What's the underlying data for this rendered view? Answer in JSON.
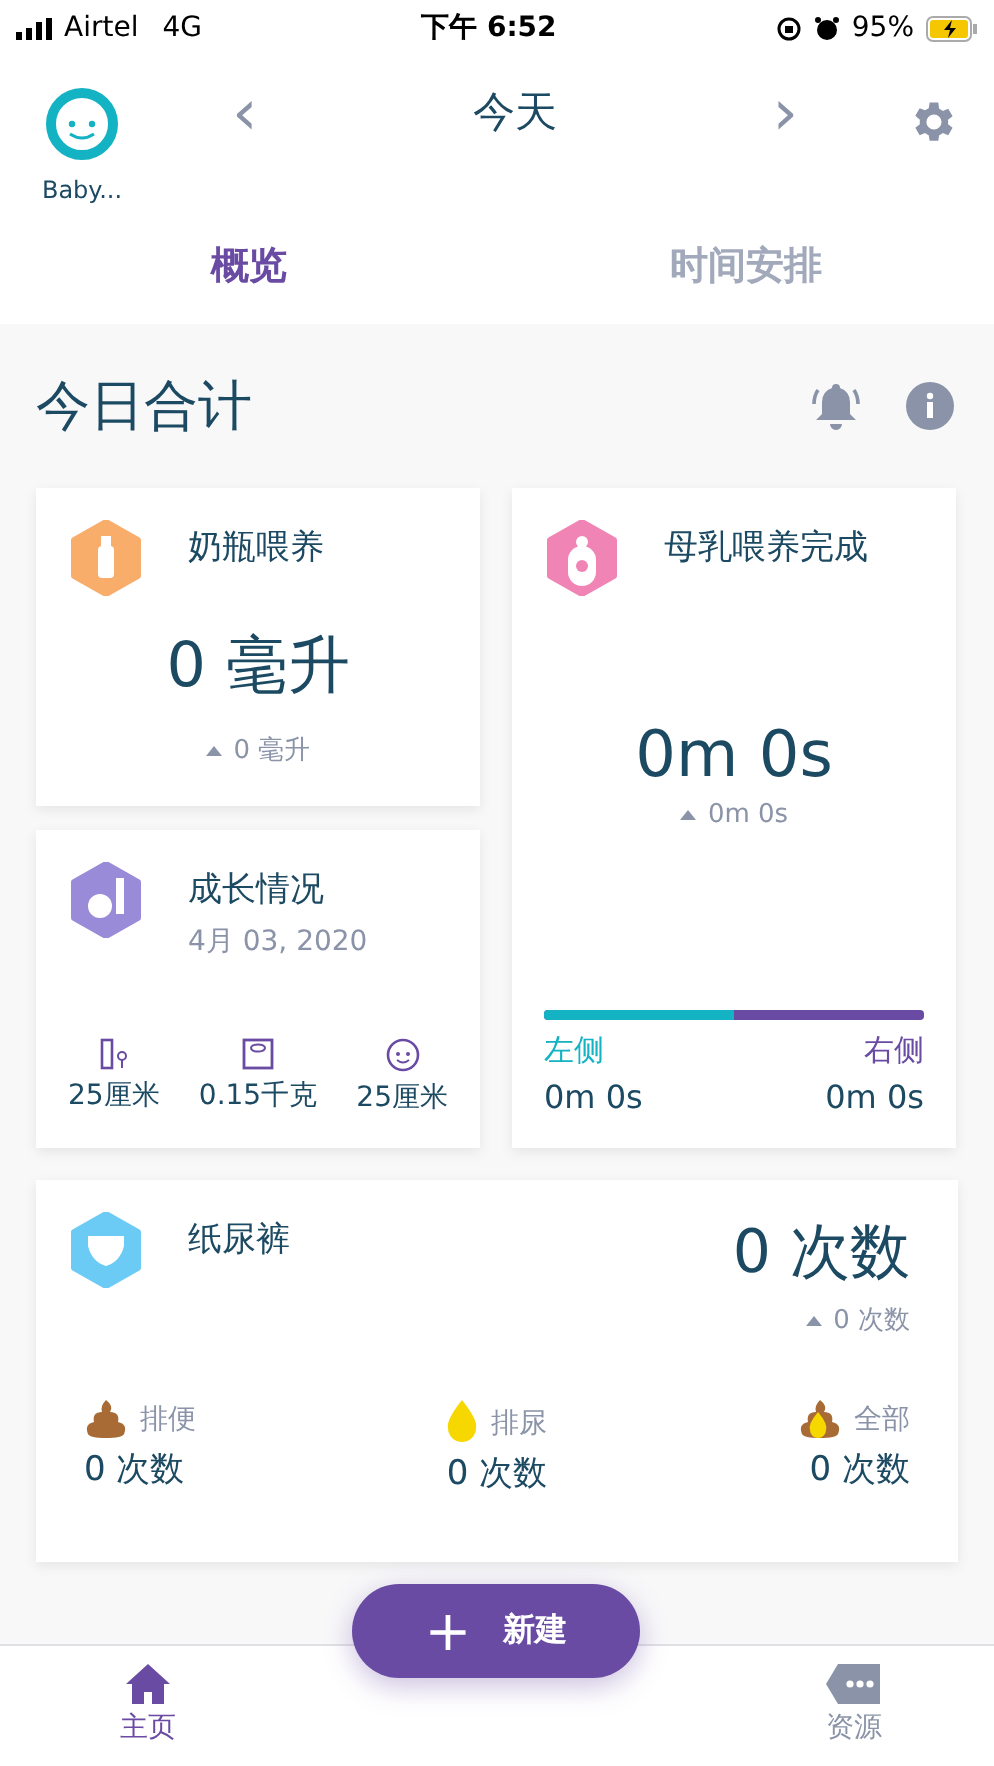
{
  "status_bar": {
    "carrier": "Airtel",
    "network": "4G",
    "time": "下午 6:52",
    "battery": "95%"
  },
  "header": {
    "baby_name": "Baby...",
    "prev": "‹",
    "title": "今天",
    "next": "›"
  },
  "tabs": [
    {
      "label": "概览",
      "selected": true
    },
    {
      "label": "时间安排",
      "selected": false
    }
  ],
  "summary": {
    "title": "今日合计"
  },
  "bottle": {
    "title": "奶瓶喂养",
    "value": "0 毫升",
    "change": "0 毫升"
  },
  "growth": {
    "title": "成长情况",
    "date": "4月 03, 2020",
    "stats": [
      {
        "kind": "height",
        "value": "25厘米"
      },
      {
        "kind": "weight",
        "value": "0.15千克"
      },
      {
        "kind": "head",
        "value": "25厘米"
      }
    ]
  },
  "breastfeeding": {
    "title": "母乳喂养完成",
    "value": "0m 0s",
    "change": "0m 0s",
    "level": 0.5,
    "left_label": "左侧",
    "left_value": "0m 0s",
    "right_label": "右侧",
    "right_value": "0m 0s"
  },
  "diaper": {
    "title": "纸尿裤",
    "value": "0 次数",
    "change": "0 次数",
    "items": [
      {
        "kind": "poo",
        "label": "排便",
        "value": "0 次数"
      },
      {
        "kind": "pee",
        "label": "排尿",
        "value": "0 次数"
      },
      {
        "kind": "both",
        "label": "全部",
        "value": "0 次数"
      }
    ]
  },
  "fab": {
    "icon": "+",
    "label": "新建"
  },
  "bottom_nav": [
    {
      "kind": "home",
      "label": "主页",
      "selected": true
    },
    {
      "kind": "resources",
      "label": "资源",
      "selected": false
    }
  ]
}
